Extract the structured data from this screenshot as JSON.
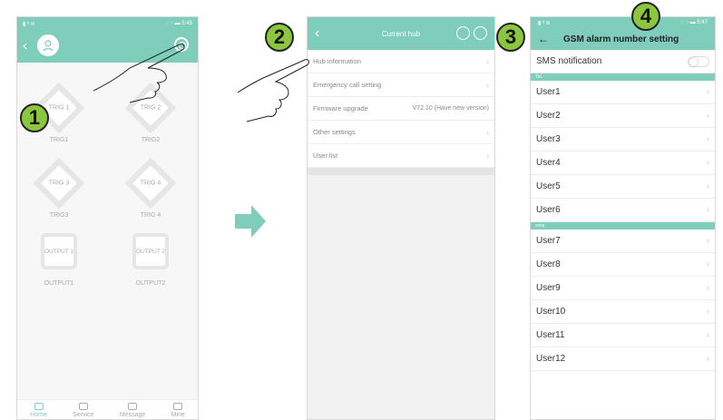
{
  "screen1": {
    "status_left": "▮ ᴵᴵ ≋",
    "status_right": "◌ ◌ ▬ 5:45",
    "devices": [
      {
        "shape": "diamond",
        "label_in": "TRIG 1",
        "label": "TRIG1"
      },
      {
        "shape": "diamond",
        "label_in": "TRIG 2",
        "label": "TRIG2"
      },
      {
        "shape": "diamond",
        "label_in": "TRIG 3",
        "label": "TRIG3"
      },
      {
        "shape": "diamond",
        "label_in": "TRIG 4",
        "label": "TRIG 4"
      },
      {
        "shape": "box",
        "label_in": "OUTPUT 1",
        "label": "OUTPUT1"
      },
      {
        "shape": "box",
        "label_in": "OUTPUT 2",
        "label": "OUTPUT2"
      }
    ],
    "tabs": [
      {
        "label": "Home",
        "active": true
      },
      {
        "label": "Service",
        "active": false
      },
      {
        "label": "Message",
        "active": false
      },
      {
        "label": "Mine",
        "active": false
      }
    ]
  },
  "screen2": {
    "title": "Current hub",
    "items": [
      {
        "label": "Hub information",
        "value": ""
      },
      {
        "label": "Emergency call setting",
        "value": ""
      },
      {
        "label": "Firmware upgrade",
        "value": "V72.10 (Have new version)"
      },
      {
        "label": "Other settings",
        "value": ""
      },
      {
        "label": "User list",
        "value": ""
      }
    ]
  },
  "screen3": {
    "status_right": "◌ ◌ ▬ 5:47",
    "title": "GSM alarm number setting",
    "sms_label": "SMS notification",
    "sms_enabled": false,
    "sections": [
      {
        "name": "Tel",
        "users": [
          "User1",
          "User2",
          "User3",
          "User4",
          "User5",
          "User6"
        ]
      },
      {
        "name": "sms",
        "users": [
          "User7",
          "User8",
          "User9",
          "User10",
          "User11",
          "User12"
        ]
      }
    ]
  },
  "markers": [
    "1",
    "2",
    "3",
    "4"
  ],
  "colors": {
    "accent": "#7fcdbb",
    "marker": "#8cc63f",
    "arrow": "#7fcdbb"
  }
}
